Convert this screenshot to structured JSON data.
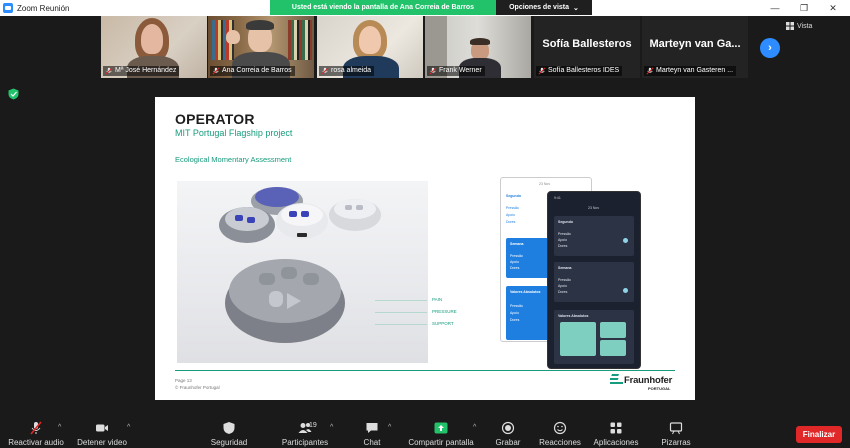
{
  "window": {
    "title": "Zoom Reunión"
  },
  "share_banner": "Usted está viendo la pantalla de Ana Correia de Barros",
  "view_options": "Opciones de vista",
  "view_button": "Vista",
  "participants": [
    {
      "name": "Mª José Hernández",
      "muted": true,
      "active": false,
      "video": true
    },
    {
      "name": "Ana Correia de Barros",
      "muted": true,
      "active": true,
      "video": true
    },
    {
      "name": "rosa almeida",
      "muted": true,
      "active": false,
      "video": true
    },
    {
      "name": "Frank Werner",
      "muted": true,
      "active": false,
      "video": true
    },
    {
      "name": "Sofía Ballesteros IDES",
      "display": "Sofía Ballesteros",
      "muted": true,
      "active": false,
      "video": false
    },
    {
      "name": "Marteyn van Gasteren ...",
      "display": "Marteyn van Ga...",
      "muted": true,
      "active": false,
      "video": false
    }
  ],
  "slide": {
    "title": "OPERATOR",
    "subtitle": "MIT Portugal Flagship project",
    "section": "Ecological Momentary Assessment",
    "annotations": [
      "PAIN",
      "PRESSURE",
      "SUPPORT"
    ],
    "footer_page": "Page 13",
    "footer_copyright": "© Fraunhofer Portugal",
    "logo_name": "Fraunhofer",
    "logo_sub": "PORTUGAL",
    "phone_light": {
      "date": "23 Nov",
      "card1_title": "Segundo",
      "card2_title": "Semana",
      "card3_title": "Valores Absolutos",
      "rows": [
        "Pressão",
        "Apoio",
        "Dores"
      ]
    },
    "phone_dark": {
      "time": "9:41",
      "date": "23 Nov",
      "card1_title": "Segundo",
      "card2_title": "Semana",
      "card3_title": "Valores Absolutos",
      "rows": [
        "Pressão",
        "Apoio",
        "Dores"
      ]
    }
  },
  "toolbar": {
    "audio": "Reactivar audio",
    "video": "Detener video",
    "security": "Seguridad",
    "participants": "Participantes",
    "participants_count": "19",
    "chat": "Chat",
    "share": "Compartir pantalla",
    "record": "Grabar",
    "reactions": "Reacciones",
    "apps": "Aplicaciones",
    "whiteboards": "Pizarras",
    "end": "Finalizar"
  },
  "colors": {
    "zoom_blue": "#2d8cff",
    "share_green": "#22c26b",
    "end_red": "#e02828",
    "fraunhofer_green": "#179c7d",
    "active_speaker": "#9bd03a"
  }
}
